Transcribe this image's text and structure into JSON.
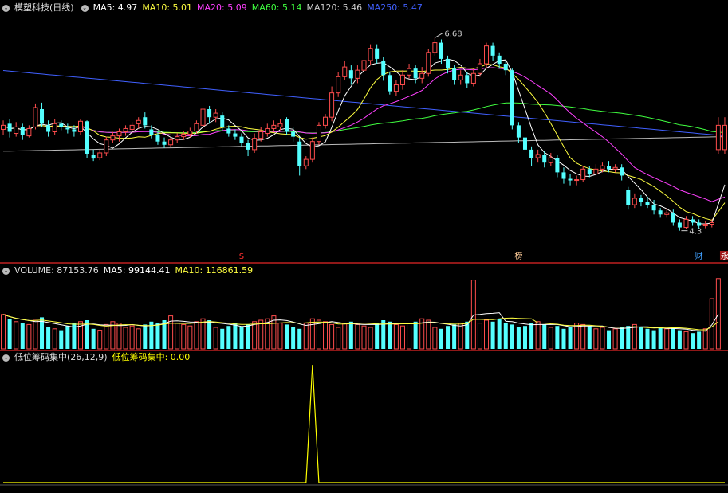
{
  "colors": {
    "up": "#ff4d4d",
    "down": "#54ffff",
    "ma5": "#ffffff",
    "ma10": "#ffff40",
    "ma20": "#ff40ff",
    "ma60": "#40ff40",
    "ma120": "#bbbbbb",
    "ma250": "#4060ff",
    "indicator": "#ffff00",
    "divider": "#c02020",
    "marker_s": "#ff3030",
    "marker_bang": "#ffcc99",
    "marker_cai": "#40a0ff",
    "marker_yong": "#ff4040"
  },
  "price_header": {
    "title": "模塑科技(日线)",
    "ma5": "MA5: 4.97",
    "ma10": "MA10: 5.01",
    "ma20": "MA20: 5.09",
    "ma60": "MA60: 5.14",
    "ma120": "MA120: 5.46",
    "ma250": "MA250: 5.47"
  },
  "volume_header": {
    "label": "VOLUME: 87153.76",
    "ma5": "MA5: 99144.41",
    "ma10": "MA10: 116861.59"
  },
  "indicator_header": {
    "label": "低位筹码集中(26,12,9)",
    "value": "低位筹码集中: 0.00"
  },
  "annotations": {
    "high": "6.68",
    "low": "4.3",
    "marker_s": "S",
    "marker_bang": "榜",
    "marker_cai": "财",
    "marker_yong": "永"
  },
  "chart_data": {
    "type": "candlestick",
    "price_ylim": [
      4.1,
      6.95
    ],
    "volume_ylim": [
      0,
      100
    ],
    "indicator_ylim": [
      0,
      1
    ],
    "indicator_spike_index": 48,
    "ma_endpoints": {
      "ma5": 4.97,
      "ma10": 5.01,
      "ma20": 5.09,
      "ma60": 5.14,
      "ma120": 5.46,
      "ma250": 5.47
    },
    "candles": [
      {
        "o": 5.55,
        "c": 5.6,
        "h": 5.66,
        "l": 5.48
      },
      {
        "o": 5.62,
        "c": 5.52,
        "h": 5.68,
        "l": 5.45
      },
      {
        "o": 5.5,
        "c": 5.58,
        "h": 5.64,
        "l": 5.46
      },
      {
        "o": 5.58,
        "c": 5.48,
        "h": 5.62,
        "l": 5.42
      },
      {
        "o": 5.47,
        "c": 5.56,
        "h": 5.6,
        "l": 5.45
      },
      {
        "o": 5.58,
        "c": 5.82,
        "h": 5.87,
        "l": 5.55
      },
      {
        "o": 5.8,
        "c": 5.62,
        "h": 5.88,
        "l": 5.58
      },
      {
        "o": 5.6,
        "c": 5.52,
        "h": 5.66,
        "l": 5.46
      },
      {
        "o": 5.52,
        "c": 5.62,
        "h": 5.68,
        "l": 5.48
      },
      {
        "o": 5.62,
        "c": 5.58,
        "h": 5.66,
        "l": 5.54
      },
      {
        "o": 5.57,
        "c": 5.55,
        "h": 5.62,
        "l": 5.5
      },
      {
        "o": 5.55,
        "c": 5.52,
        "h": 5.6,
        "l": 5.46
      },
      {
        "o": 5.52,
        "c": 5.65,
        "h": 5.68,
        "l": 5.48
      },
      {
        "o": 5.65,
        "c": 5.25,
        "h": 5.66,
        "l": 5.2
      },
      {
        "o": 5.24,
        "c": 5.19,
        "h": 5.3,
        "l": 5.16
      },
      {
        "o": 5.2,
        "c": 5.26,
        "h": 5.3,
        "l": 5.17
      },
      {
        "o": 5.26,
        "c": 5.42,
        "h": 5.46,
        "l": 5.22
      },
      {
        "o": 5.42,
        "c": 5.47,
        "h": 5.52,
        "l": 5.38
      },
      {
        "o": 5.47,
        "c": 5.52,
        "h": 5.56,
        "l": 5.4
      },
      {
        "o": 5.52,
        "c": 5.56,
        "h": 5.6,
        "l": 5.47
      },
      {
        "o": 5.55,
        "c": 5.6,
        "h": 5.64,
        "l": 5.5
      },
      {
        "o": 5.62,
        "c": 5.66,
        "h": 5.7,
        "l": 5.56
      },
      {
        "o": 5.7,
        "c": 5.6,
        "h": 5.76,
        "l": 5.56
      },
      {
        "o": 5.55,
        "c": 5.48,
        "h": 5.6,
        "l": 5.44
      },
      {
        "o": 5.48,
        "c": 5.4,
        "h": 5.52,
        "l": 5.36
      },
      {
        "o": 5.4,
        "c": 5.36,
        "h": 5.45,
        "l": 5.32
      },
      {
        "o": 5.36,
        "c": 5.42,
        "h": 5.45,
        "l": 5.33
      },
      {
        "o": 5.42,
        "c": 5.46,
        "h": 5.5,
        "l": 5.38
      },
      {
        "o": 5.46,
        "c": 5.49,
        "h": 5.53,
        "l": 5.42
      },
      {
        "o": 5.49,
        "c": 5.53,
        "h": 5.57,
        "l": 5.45
      },
      {
        "o": 5.53,
        "c": 5.62,
        "h": 5.66,
        "l": 5.5
      },
      {
        "o": 5.6,
        "c": 5.8,
        "h": 5.85,
        "l": 5.56
      },
      {
        "o": 5.8,
        "c": 5.7,
        "h": 5.84,
        "l": 5.62
      },
      {
        "o": 5.7,
        "c": 5.75,
        "h": 5.8,
        "l": 5.64
      },
      {
        "o": 5.72,
        "c": 5.58,
        "h": 5.76,
        "l": 5.54
      },
      {
        "o": 5.56,
        "c": 5.5,
        "h": 5.6,
        "l": 5.46
      },
      {
        "o": 5.5,
        "c": 5.46,
        "h": 5.55,
        "l": 5.42
      },
      {
        "o": 5.46,
        "c": 5.38,
        "h": 5.5,
        "l": 5.34
      },
      {
        "o": 5.38,
        "c": 5.3,
        "h": 5.42,
        "l": 5.22
      },
      {
        "o": 5.3,
        "c": 5.44,
        "h": 5.5,
        "l": 5.26
      },
      {
        "o": 5.44,
        "c": 5.52,
        "h": 5.58,
        "l": 5.4
      },
      {
        "o": 5.5,
        "c": 5.56,
        "h": 5.62,
        "l": 5.46
      },
      {
        "o": 5.56,
        "c": 5.6,
        "h": 5.66,
        "l": 5.52
      },
      {
        "o": 5.58,
        "c": 5.62,
        "h": 5.68,
        "l": 5.54
      },
      {
        "o": 5.68,
        "c": 5.52,
        "h": 5.7,
        "l": 5.48
      },
      {
        "o": 5.52,
        "c": 5.46,
        "h": 5.58,
        "l": 5.4
      },
      {
        "o": 5.4,
        "c": 5.1,
        "h": 5.45,
        "l": 4.98
      },
      {
        "o": 5.1,
        "c": 5.18,
        "h": 5.22,
        "l": 5.06
      },
      {
        "o": 5.18,
        "c": 5.4,
        "h": 5.45,
        "l": 5.14
      },
      {
        "o": 5.4,
        "c": 5.6,
        "h": 5.64,
        "l": 5.36
      },
      {
        "o": 5.6,
        "c": 5.7,
        "h": 5.74,
        "l": 5.56
      },
      {
        "o": 5.7,
        "c": 6.0,
        "h": 6.08,
        "l": 5.65
      },
      {
        "o": 6.0,
        "c": 6.2,
        "h": 6.26,
        "l": 5.95
      },
      {
        "o": 6.2,
        "c": 6.32,
        "h": 6.4,
        "l": 6.16
      },
      {
        "o": 6.28,
        "c": 6.18,
        "h": 6.34,
        "l": 6.1
      },
      {
        "o": 6.18,
        "c": 6.28,
        "h": 6.34,
        "l": 6.12
      },
      {
        "o": 6.28,
        "c": 6.4,
        "h": 6.46,
        "l": 6.22
      },
      {
        "o": 6.4,
        "c": 6.55,
        "h": 6.6,
        "l": 6.34
      },
      {
        "o": 6.55,
        "c": 6.42,
        "h": 6.6,
        "l": 6.36
      },
      {
        "o": 6.4,
        "c": 6.22,
        "h": 6.44,
        "l": 6.15
      },
      {
        "o": 6.22,
        "c": 6.02,
        "h": 6.26,
        "l": 5.98
      },
      {
        "o": 6.02,
        "c": 6.1,
        "h": 6.16,
        "l": 5.96
      },
      {
        "o": 6.1,
        "c": 6.22,
        "h": 6.28,
        "l": 6.04
      },
      {
        "o": 6.22,
        "c": 6.3,
        "h": 6.36,
        "l": 6.18
      },
      {
        "o": 6.3,
        "c": 6.18,
        "h": 6.34,
        "l": 6.12
      },
      {
        "o": 6.18,
        "c": 6.24,
        "h": 6.32,
        "l": 6.12
      },
      {
        "o": 6.24,
        "c": 6.5,
        "h": 6.54,
        "l": 6.2
      },
      {
        "o": 6.5,
        "c": 6.62,
        "h": 6.68,
        "l": 6.46
      },
      {
        "o": 6.62,
        "c": 6.42,
        "h": 6.66,
        "l": 6.36
      },
      {
        "o": 6.42,
        "c": 6.3,
        "h": 6.46,
        "l": 6.24
      },
      {
        "o": 6.3,
        "c": 6.16,
        "h": 6.34,
        "l": 6.1
      },
      {
        "o": 6.16,
        "c": 6.22,
        "h": 6.28,
        "l": 6.1
      },
      {
        "o": 6.22,
        "c": 6.12,
        "h": 6.26,
        "l": 6.06
      },
      {
        "o": 6.12,
        "c": 6.24,
        "h": 6.3,
        "l": 6.08
      },
      {
        "o": 6.24,
        "c": 6.36,
        "h": 6.42,
        "l": 6.2
      },
      {
        "o": 6.36,
        "c": 6.58,
        "h": 6.62,
        "l": 6.3
      },
      {
        "o": 6.58,
        "c": 6.46,
        "h": 6.62,
        "l": 6.4
      },
      {
        "o": 6.46,
        "c": 6.36,
        "h": 6.5,
        "l": 6.3
      },
      {
        "o": 6.36,
        "c": 6.28,
        "h": 6.4,
        "l": 6.22
      },
      {
        "o": 6.28,
        "c": 5.6,
        "h": 6.3,
        "l": 5.55
      },
      {
        "o": 5.6,
        "c": 5.45,
        "h": 5.64,
        "l": 5.38
      },
      {
        "o": 5.45,
        "c": 5.3,
        "h": 5.5,
        "l": 5.24
      },
      {
        "o": 5.3,
        "c": 5.2,
        "h": 5.34,
        "l": 5.1
      },
      {
        "o": 5.2,
        "c": 5.24,
        "h": 5.3,
        "l": 5.14
      },
      {
        "o": 5.24,
        "c": 5.14,
        "h": 5.28,
        "l": 5.08
      },
      {
        "o": 5.14,
        "c": 5.2,
        "h": 5.26,
        "l": 5.1
      },
      {
        "o": 5.2,
        "c": 5.02,
        "h": 5.24,
        "l": 4.96
      },
      {
        "o": 5.02,
        "c": 4.94,
        "h": 5.08,
        "l": 4.88
      },
      {
        "o": 4.94,
        "c": 4.92,
        "h": 5.0,
        "l": 4.86
      },
      {
        "o": 4.92,
        "c": 4.93,
        "h": 4.98,
        "l": 4.86
      },
      {
        "o": 4.93,
        "c": 5.06,
        "h": 5.1,
        "l": 4.9
      },
      {
        "o": 5.06,
        "c": 5.0,
        "h": 5.1,
        "l": 4.96
      },
      {
        "o": 5.0,
        "c": 5.06,
        "h": 5.12,
        "l": 4.98
      },
      {
        "o": 5.06,
        "c": 5.1,
        "h": 5.14,
        "l": 5.02
      },
      {
        "o": 5.1,
        "c": 5.06,
        "h": 5.16,
        "l": 5.02
      },
      {
        "o": 5.06,
        "c": 5.08,
        "h": 5.12,
        "l": 5.02
      },
      {
        "o": 5.08,
        "c": 4.98,
        "h": 5.12,
        "l": 4.92
      },
      {
        "o": 4.8,
        "c": 4.62,
        "h": 4.84,
        "l": 4.56
      },
      {
        "o": 4.62,
        "c": 4.7,
        "h": 4.76,
        "l": 4.58
      },
      {
        "o": 4.7,
        "c": 4.66,
        "h": 4.74,
        "l": 4.6
      },
      {
        "o": 4.66,
        "c": 4.62,
        "h": 4.72,
        "l": 4.58
      },
      {
        "o": 4.62,
        "c": 4.55,
        "h": 4.68,
        "l": 4.5
      },
      {
        "o": 4.55,
        "c": 4.5,
        "h": 4.58,
        "l": 4.46
      },
      {
        "o": 4.5,
        "c": 4.52,
        "h": 4.58,
        "l": 4.46
      },
      {
        "o": 4.52,
        "c": 4.4,
        "h": 4.56,
        "l": 4.36
      },
      {
        "o": 4.4,
        "c": 4.34,
        "h": 4.44,
        "l": 4.3
      },
      {
        "o": 4.34,
        "c": 4.44,
        "h": 4.48,
        "l": 4.32
      },
      {
        "o": 4.44,
        "c": 4.4,
        "h": 4.48,
        "l": 4.36
      },
      {
        "o": 4.4,
        "c": 4.36,
        "h": 4.44,
        "l": 4.32
      },
      {
        "o": 4.36,
        "c": 4.38,
        "h": 4.42,
        "l": 4.33
      },
      {
        "o": 4.38,
        "c": 4.4,
        "h": 4.44,
        "l": 4.34
      },
      {
        "o": 5.3,
        "c": 5.6,
        "h": 5.7,
        "l": 5.25
      },
      {
        "o": 5.3,
        "c": 5.6,
        "h": 5.7,
        "l": 5.25
      }
    ],
    "volume": [
      48,
      42,
      38,
      36,
      34,
      40,
      44,
      30,
      28,
      26,
      32,
      36,
      38,
      40,
      28,
      26,
      34,
      38,
      36,
      30,
      32,
      28,
      34,
      38,
      36,
      40,
      46,
      36,
      34,
      32,
      38,
      42,
      40,
      30,
      28,
      32,
      36,
      30,
      34,
      38,
      40,
      42,
      46,
      36,
      34,
      30,
      28,
      36,
      42,
      40,
      38,
      34,
      30,
      36,
      38,
      34,
      32,
      30,
      36,
      40,
      38,
      34,
      32,
      36,
      38,
      42,
      40,
      30,
      28,
      32,
      34,
      36,
      38,
      96,
      36,
      40,
      38,
      42,
      36,
      34,
      30,
      32,
      36,
      38,
      34,
      30,
      32,
      28,
      30,
      36,
      34,
      32,
      28,
      30,
      26,
      28,
      30,
      32,
      34,
      30,
      28,
      26,
      30,
      28,
      30,
      26,
      24,
      22,
      24,
      28,
      70,
      98
    ]
  }
}
